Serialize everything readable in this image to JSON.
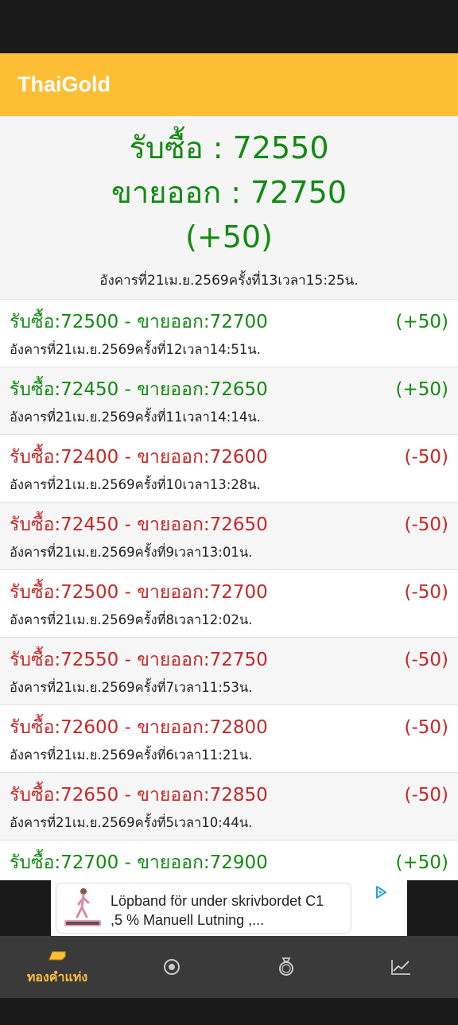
{
  "app": {
    "title": "ThaiGold"
  },
  "current": {
    "buy": "รับซื้อ : 72550",
    "sell": "ขายออก : 72750",
    "change": "(+50)",
    "timestamp": "อังคารที่21เม.ย.2569ครั้งที่13เวลา15:25น."
  },
  "history": [
    {
      "price": "รับซื้อ:72500 - ขายออก:72700",
      "change": "(+50)",
      "time": "อังคารที่21เม.ย.2569ครั้งที่12เวลา14:51น.",
      "trend": "up"
    },
    {
      "price": "รับซื้อ:72450 - ขายออก:72650",
      "change": "(+50)",
      "time": "อังคารที่21เม.ย.2569ครั้งที่11เวลา14:14น.",
      "trend": "up"
    },
    {
      "price": "รับซื้อ:72400 - ขายออก:72600",
      "change": "(-50)",
      "time": "อังคารที่21เม.ย.2569ครั้งที่10เวลา13:28น.",
      "trend": "down"
    },
    {
      "price": "รับซื้อ:72450 - ขายออก:72650",
      "change": "(-50)",
      "time": "อังคารที่21เม.ย.2569ครั้งที่9เวลา13:01น.",
      "trend": "down"
    },
    {
      "price": "รับซื้อ:72500 - ขายออก:72700",
      "change": "(-50)",
      "time": "อังคารที่21เม.ย.2569ครั้งที่8เวลา12:02น.",
      "trend": "down"
    },
    {
      "price": "รับซื้อ:72550 - ขายออก:72750",
      "change": "(-50)",
      "time": "อังคารที่21เม.ย.2569ครั้งที่7เวลา11:53น.",
      "trend": "down"
    },
    {
      "price": "รับซื้อ:72600 - ขายออก:72800",
      "change": "(-50)",
      "time": "อังคารที่21เม.ย.2569ครั้งที่6เวลา11:21น.",
      "trend": "down"
    },
    {
      "price": "รับซื้อ:72650 - ขายออก:72850",
      "change": "(-50)",
      "time": "อังคารที่21เม.ย.2569ครั้งที่5เวลา10:44น.",
      "trend": "down"
    },
    {
      "price": "รับซื้อ:72700 - ขายออก:72900",
      "change": "(+50)",
      "time": "",
      "trend": "up"
    }
  ],
  "ad": {
    "line1": "Löpband för under skrivbordet C1",
    "line2": ",5 % Manuell Lutning ,...",
    "thumb_icon": "treadmill-image",
    "choices_icon": "ad-choices-icon"
  },
  "nav": {
    "items": [
      {
        "label": "ทองคำแท่ง",
        "icon": "gold-bar-icon",
        "active": true
      },
      {
        "label": "",
        "icon": "radio-target-icon",
        "active": false
      },
      {
        "label": "",
        "icon": "ring-icon",
        "active": false
      },
      {
        "label": "",
        "icon": "trend-chart-icon",
        "active": false
      }
    ]
  },
  "colors": {
    "accent": "#fcbe35",
    "up": "#128a12",
    "down": "#c62828",
    "nav_bg": "#3a3a3a"
  }
}
